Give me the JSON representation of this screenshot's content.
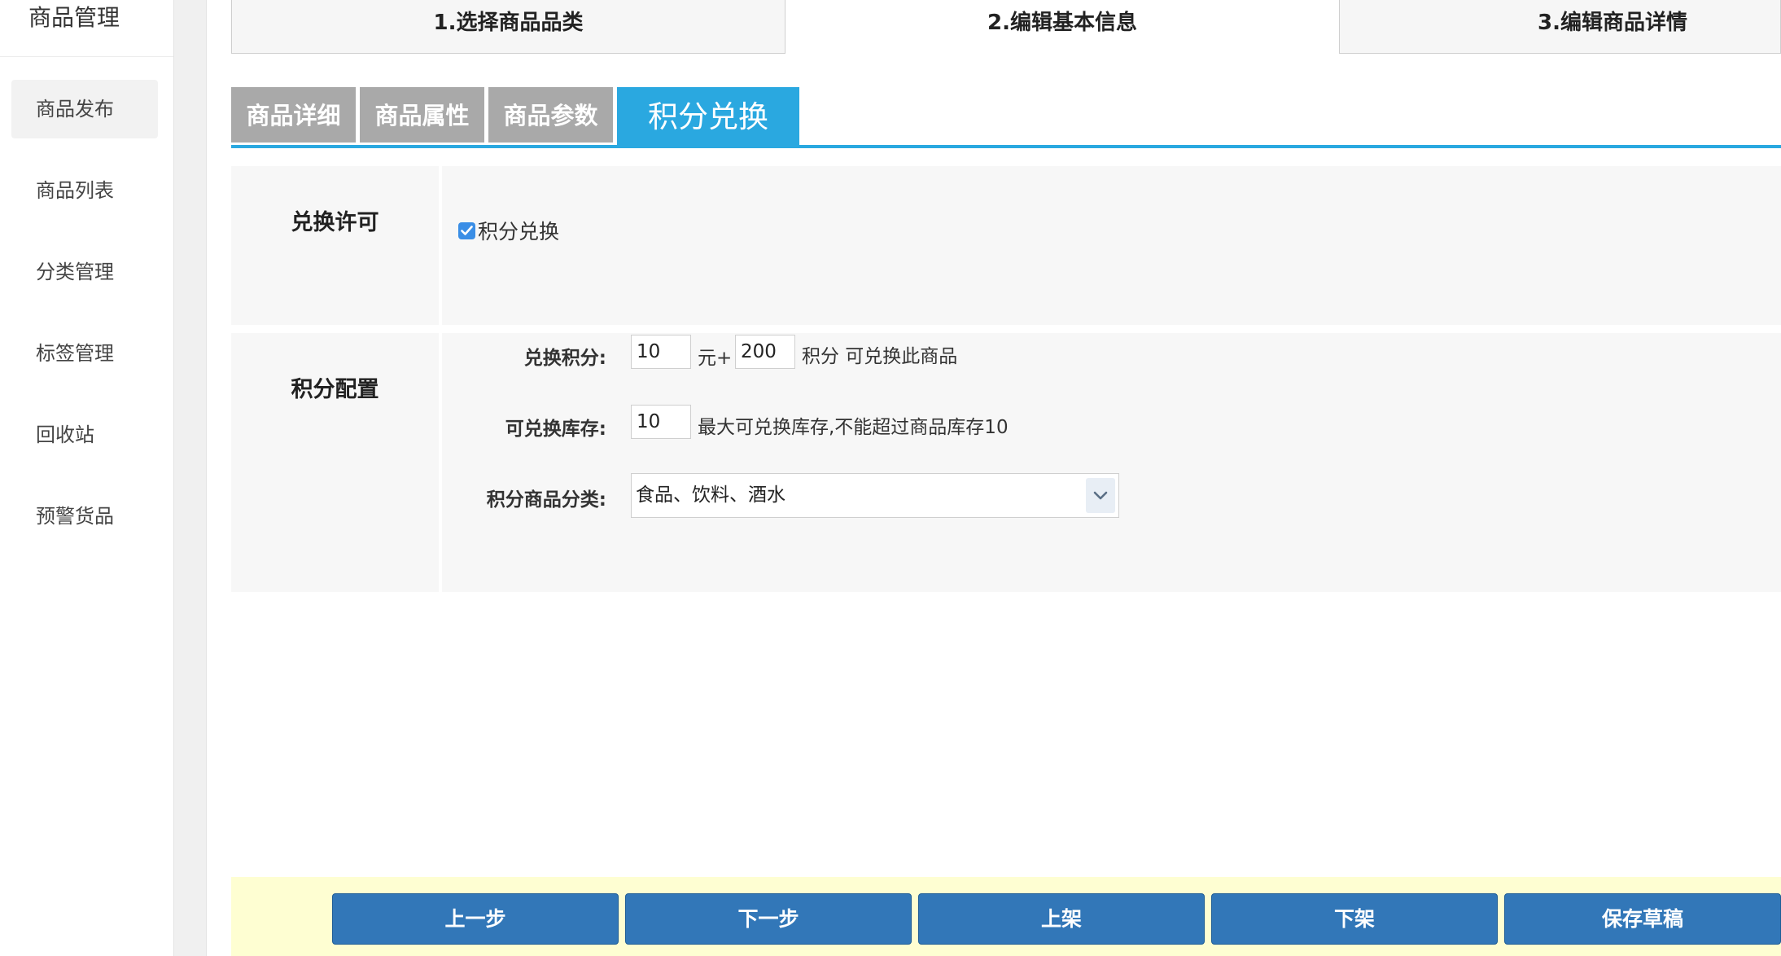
{
  "sidebar": {
    "title": "商品管理",
    "items": [
      {
        "label": "商品发布"
      },
      {
        "label": "商品列表"
      },
      {
        "label": "分类管理"
      },
      {
        "label": "标签管理"
      },
      {
        "label": "回收站"
      },
      {
        "label": "预警货品"
      }
    ],
    "active_index": 0
  },
  "steps": [
    {
      "label": "1.选择商品品类"
    },
    {
      "label": "2.编辑基本信息"
    },
    {
      "label": "3.编辑商品详情"
    }
  ],
  "tabs": [
    {
      "label": "商品详细"
    },
    {
      "label": "商品属性"
    },
    {
      "label": "商品参数"
    },
    {
      "label": "积分兑换"
    }
  ],
  "exchange_permission": {
    "section_label": "兑换许可",
    "checkbox_label": "积分兑换",
    "checked": true
  },
  "points_config": {
    "section_label": "积分配置",
    "exchange_points_label": "兑换积分:",
    "price_value": "10",
    "yuan_plus": "元+",
    "points_value": "200",
    "points_suffix": "积分 可兑换此商品",
    "stock_label": "可兑换库存:",
    "stock_value": "10",
    "stock_hint": "最大可兑换库存,不能超过商品库存10",
    "category_label": "积分商品分类:",
    "category_value": "食品、饮料、酒水"
  },
  "footer_buttons": {
    "prev": "上一步",
    "next": "下一步",
    "list": "上架",
    "delist": "下架",
    "save_draft": "保存草稿"
  },
  "colors": {
    "accent": "#2aa8e0",
    "button": "#3277b8",
    "footer_bg": "#fefed2",
    "checkbox": "#3a8ee6"
  }
}
